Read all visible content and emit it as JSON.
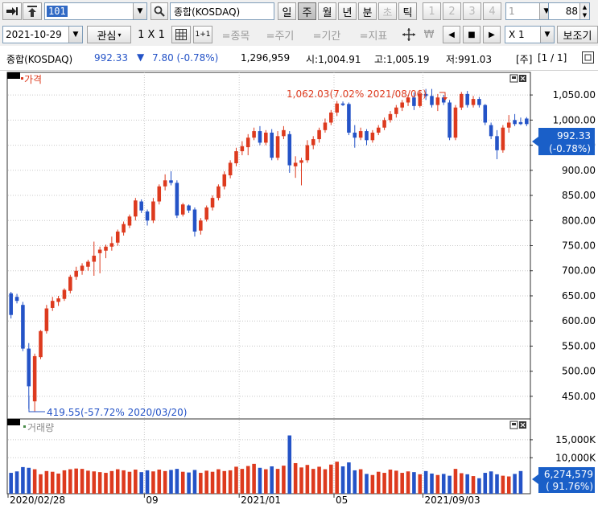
{
  "toolbar1": {
    "code": "101",
    "index_name": "종합(KOSDAQ)",
    "period_tabs": [
      {
        "label": "일",
        "selected": false,
        "enabled": true
      },
      {
        "label": "주",
        "selected": true,
        "enabled": true
      },
      {
        "label": "월",
        "selected": false,
        "enabled": true
      },
      {
        "label": "년",
        "selected": false,
        "enabled": true
      },
      {
        "label": "분",
        "selected": false,
        "enabled": true
      },
      {
        "label": "초",
        "selected": false,
        "enabled": false
      },
      {
        "label": "틱",
        "selected": false,
        "enabled": true
      }
    ],
    "interval_buttons": [
      "1",
      "2",
      "3",
      "4"
    ],
    "interval_value": "1",
    "count_value": "88"
  },
  "toolbar2": {
    "date": "2021-10-29",
    "watchlist_label": "관심",
    "layout_label": "1 X 1",
    "layout_small_label": "1+1",
    "item_button": "=종목",
    "cycle_button": "=주기",
    "period_button": "=기간",
    "indicator_button": "=지표",
    "currency_symbol": "₩",
    "zoom_value": "X 1",
    "sub_button": "보조기"
  },
  "info_bar": {
    "name": "종합(KOSDAQ)",
    "price": "992.33",
    "change_arrow": "▼",
    "change": "7.80 (-0.78%)",
    "volume": "1,296,959",
    "open": "시:1,004.91",
    "high": "고:1,005.19",
    "low": "저:991.03",
    "period": "[주]",
    "page": "[1 / 1]"
  },
  "price_panel": {
    "label": "가격",
    "high_note": "1,062.03(7.02% 2021/08/06)",
    "low_note": "419.55(-57.72% 2020/03/20)",
    "y_ticks": [
      "1,050.00",
      "1,000.00",
      "950.00",
      "900.00",
      "850.00",
      "800.00",
      "750.00",
      "700.00",
      "650.00",
      "600.00",
      "550.00",
      "500.00",
      "450.00"
    ],
    "last_price": "992.33",
    "last_change": "(-0.78%)"
  },
  "volume_panel": {
    "label": "거래량",
    "y_ticks": [
      "15,000K",
      "10,000K"
    ],
    "last_volume": "6,274,579",
    "last_ratio": "( 91.76%)"
  },
  "x_axis": {
    "labels": [
      "2020/02/28",
      "09",
      "2021/01",
      "05",
      "2021/09/03"
    ]
  },
  "colors": {
    "up": "#dd3a1e",
    "down": "#2453c7",
    "badge": "#1a5fc8"
  },
  "chart_data": {
    "type": "candlestick",
    "ylim": [
      405,
      1095
    ],
    "candles": [
      {
        "o": 655,
        "h": 658,
        "l": 605,
        "c": 612
      },
      {
        "o": 648,
        "h": 654,
        "l": 635,
        "c": 640
      },
      {
        "o": 632,
        "h": 638,
        "l": 540,
        "c": 545
      },
      {
        "o": 545,
        "h": 556,
        "l": 425,
        "c": 470
      },
      {
        "o": 440,
        "h": 535,
        "l": 420,
        "c": 530
      },
      {
        "o": 528,
        "h": 582,
        "l": 524,
        "c": 580
      },
      {
        "o": 580,
        "h": 632,
        "l": 575,
        "c": 625
      },
      {
        "o": 626,
        "h": 648,
        "l": 620,
        "c": 640
      },
      {
        "o": 638,
        "h": 650,
        "l": 630,
        "c": 645
      },
      {
        "o": 644,
        "h": 665,
        "l": 640,
        "c": 662
      },
      {
        "o": 660,
        "h": 692,
        "l": 655,
        "c": 688
      },
      {
        "o": 688,
        "h": 708,
        "l": 682,
        "c": 700
      },
      {
        "o": 700,
        "h": 715,
        "l": 692,
        "c": 710
      },
      {
        "o": 708,
        "h": 722,
        "l": 700,
        "c": 718
      },
      {
        "o": 718,
        "h": 758,
        "l": 690,
        "c": 730
      },
      {
        "o": 735,
        "h": 748,
        "l": 695,
        "c": 742
      },
      {
        "o": 740,
        "h": 752,
        "l": 725,
        "c": 748
      },
      {
        "o": 748,
        "h": 768,
        "l": 740,
        "c": 755
      },
      {
        "o": 756,
        "h": 782,
        "l": 750,
        "c": 778
      },
      {
        "o": 776,
        "h": 798,
        "l": 770,
        "c": 793
      },
      {
        "o": 790,
        "h": 812,
        "l": 785,
        "c": 808
      },
      {
        "o": 808,
        "h": 845,
        "l": 800,
        "c": 840
      },
      {
        "o": 838,
        "h": 842,
        "l": 815,
        "c": 820
      },
      {
        "o": 818,
        "h": 822,
        "l": 790,
        "c": 800
      },
      {
        "o": 800,
        "h": 845,
        "l": 795,
        "c": 838
      },
      {
        "o": 838,
        "h": 872,
        "l": 832,
        "c": 868
      },
      {
        "o": 868,
        "h": 892,
        "l": 860,
        "c": 880
      },
      {
        "o": 880,
        "h": 898,
        "l": 870,
        "c": 875
      },
      {
        "o": 875,
        "h": 880,
        "l": 805,
        "c": 810
      },
      {
        "o": 812,
        "h": 835,
        "l": 808,
        "c": 832
      },
      {
        "o": 830,
        "h": 832,
        "l": 815,
        "c": 820
      },
      {
        "o": 822,
        "h": 826,
        "l": 768,
        "c": 778
      },
      {
        "o": 780,
        "h": 805,
        "l": 772,
        "c": 800
      },
      {
        "o": 802,
        "h": 830,
        "l": 798,
        "c": 826
      },
      {
        "o": 826,
        "h": 850,
        "l": 820,
        "c": 845
      },
      {
        "o": 845,
        "h": 872,
        "l": 840,
        "c": 868
      },
      {
        "o": 868,
        "h": 898,
        "l": 862,
        "c": 892
      },
      {
        "o": 890,
        "h": 920,
        "l": 884,
        "c": 915
      },
      {
        "o": 914,
        "h": 945,
        "l": 908,
        "c": 938
      },
      {
        "o": 938,
        "h": 958,
        "l": 930,
        "c": 948
      },
      {
        "o": 946,
        "h": 972,
        "l": 930,
        "c": 965
      },
      {
        "o": 965,
        "h": 985,
        "l": 960,
        "c": 978
      },
      {
        "o": 978,
        "h": 988,
        "l": 950,
        "c": 955
      },
      {
        "o": 955,
        "h": 980,
        "l": 950,
        "c": 975
      },
      {
        "o": 975,
        "h": 982,
        "l": 920,
        "c": 925
      },
      {
        "o": 925,
        "h": 978,
        "l": 920,
        "c": 968
      },
      {
        "o": 968,
        "h": 988,
        "l": 962,
        "c": 980
      },
      {
        "o": 972,
        "h": 978,
        "l": 895,
        "c": 910
      },
      {
        "o": 908,
        "h": 928,
        "l": 885,
        "c": 915
      },
      {
        "o": 915,
        "h": 925,
        "l": 870,
        "c": 920
      },
      {
        "o": 920,
        "h": 960,
        "l": 915,
        "c": 950
      },
      {
        "o": 950,
        "h": 968,
        "l": 942,
        "c": 962
      },
      {
        "o": 962,
        "h": 985,
        "l": 955,
        "c": 980
      },
      {
        "o": 980,
        "h": 1003,
        "l": 975,
        "c": 995
      },
      {
        "o": 995,
        "h": 1020,
        "l": 990,
        "c": 1015
      },
      {
        "o": 1015,
        "h": 1038,
        "l": 1008,
        "c": 1033
      },
      {
        "o": 1033,
        "h": 1037,
        "l": 1028,
        "c": 1030
      },
      {
        "o": 1032,
        "h": 1035,
        "l": 970,
        "c": 975
      },
      {
        "o": 975,
        "h": 990,
        "l": 945,
        "c": 965
      },
      {
        "o": 965,
        "h": 985,
        "l": 960,
        "c": 978
      },
      {
        "o": 978,
        "h": 982,
        "l": 950,
        "c": 960
      },
      {
        "o": 960,
        "h": 980,
        "l": 955,
        "c": 975
      },
      {
        "o": 975,
        "h": 990,
        "l": 970,
        "c": 985
      },
      {
        "o": 985,
        "h": 1005,
        "l": 980,
        "c": 1000
      },
      {
        "o": 1000,
        "h": 1018,
        "l": 995,
        "c": 1012
      },
      {
        "o": 1012,
        "h": 1030,
        "l": 1005,
        "c": 1025
      },
      {
        "o": 1025,
        "h": 1040,
        "l": 1018,
        "c": 1035
      },
      {
        "o": 1035,
        "h": 1050,
        "l": 1028,
        "c": 1045
      },
      {
        "o": 1045,
        "h": 1055,
        "l": 1020,
        "c": 1028
      },
      {
        "o": 1028,
        "h": 1060,
        "l": 1025,
        "c": 1052
      },
      {
        "o": 1052,
        "h": 1062,
        "l": 1040,
        "c": 1048
      },
      {
        "o": 1048,
        "h": 1062,
        "l": 1025,
        "c": 1030
      },
      {
        "o": 1030,
        "h": 1052,
        "l": 1018,
        "c": 1045
      },
      {
        "o": 1045,
        "h": 1050,
        "l": 1030,
        "c": 1035
      },
      {
        "o": 1035,
        "h": 1040,
        "l": 960,
        "c": 965
      },
      {
        "o": 965,
        "h": 1030,
        "l": 960,
        "c": 1025
      },
      {
        "o": 1025,
        "h": 1056,
        "l": 1020,
        "c": 1052
      },
      {
        "o": 1052,
        "h": 1058,
        "l": 1025,
        "c": 1030
      },
      {
        "o": 1030,
        "h": 1048,
        "l": 1025,
        "c": 1042
      },
      {
        "o": 1042,
        "h": 1046,
        "l": 1025,
        "c": 1030
      },
      {
        "o": 1030,
        "h": 1032,
        "l": 990,
        "c": 995
      },
      {
        "o": 990,
        "h": 995,
        "l": 962,
        "c": 968
      },
      {
        "o": 968,
        "h": 980,
        "l": 922,
        "c": 940
      },
      {
        "o": 940,
        "h": 990,
        "l": 935,
        "c": 985
      },
      {
        "o": 985,
        "h": 1010,
        "l": 975,
        "c": 995
      },
      {
        "o": 1000,
        "h": 1012,
        "l": 988,
        "c": 992
      },
      {
        "o": 996,
        "h": 1005,
        "l": 990,
        "c": 992
      },
      {
        "o": 1003,
        "h": 1006,
        "l": 988,
        "c": 992
      }
    ],
    "volume_ylim": [
      0,
      19000
    ],
    "volumes": [
      5800,
      6200,
      7400,
      7200,
      6800,
      5400,
      6300,
      6100,
      5600,
      6500,
      6800,
      7000,
      6900,
      6400,
      6200,
      6000,
      5800,
      6300,
      6800,
      6500,
      6100,
      6700,
      6000,
      6500,
      6200,
      6700,
      6300,
      6600,
      6900,
      6100,
      5900,
      6600,
      5800,
      6400,
      6100,
      6800,
      6300,
      6500,
      7500,
      6900,
      7700,
      8300,
      7200,
      6800,
      7600,
      6900,
      7800,
      16200,
      8500,
      7300,
      8000,
      6900,
      7500,
      6800,
      8100,
      8900,
      7600,
      8700,
      6500,
      6800,
      5500,
      5200,
      6100,
      5800,
      6700,
      6400,
      5800,
      6200,
      6000,
      5400,
      6300,
      5600,
      5200,
      5500,
      5000,
      6900,
      5700,
      5400,
      4900,
      4300,
      5800,
      6200,
      5400,
      5000,
      4800,
      5500,
      6300
    ]
  }
}
